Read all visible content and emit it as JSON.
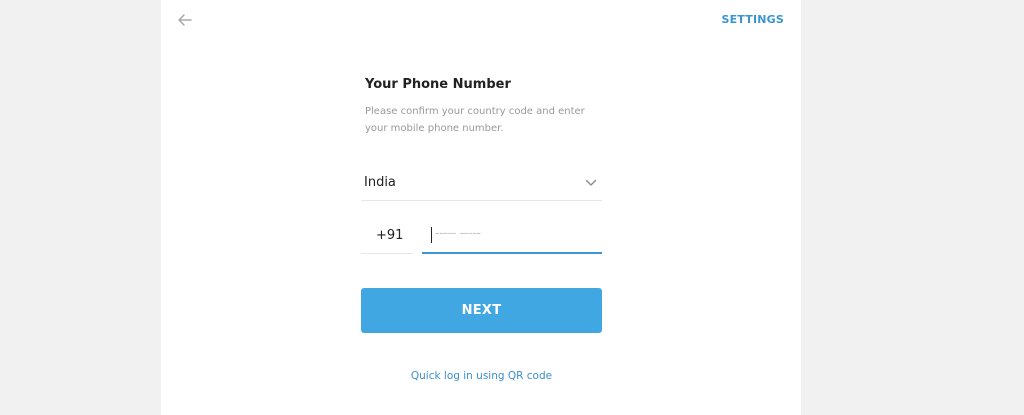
{
  "header": {
    "back_icon": "arrow-left-icon",
    "settings_label": "SETTINGS"
  },
  "form": {
    "title": "Your Phone Number",
    "subtitle": "Please confirm your country code and enter your mobile phone number.",
    "country": {
      "value": "India",
      "icon": "chevron-down-icon"
    },
    "country_code": "+91",
    "phone": {
      "value": "",
      "placeholder": "----- -----"
    },
    "next_label": "NEXT",
    "qr_link_label": "Quick log in using QR code"
  },
  "colors": {
    "accent": "#40a7e3",
    "link": "#3a95d5",
    "page_background": "#f1f1f1",
    "panel_background": "#ffffff"
  }
}
